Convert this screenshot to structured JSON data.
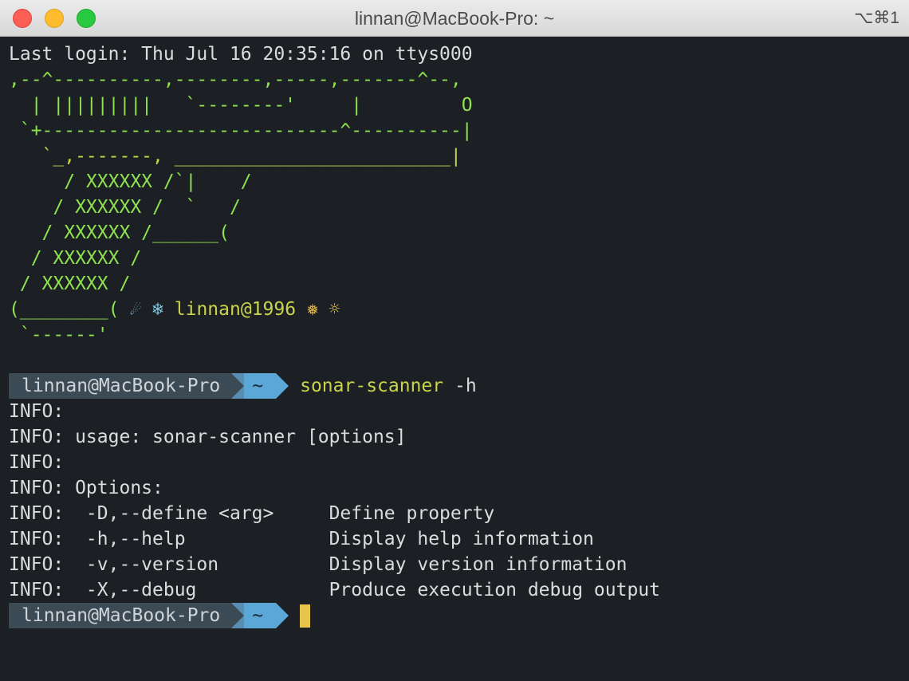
{
  "window": {
    "title": "linnan@MacBook-Pro: ~",
    "shortcut": "⌥⌘1"
  },
  "terminal": {
    "last_login": "Last login: Thu Jul 16 20:35:16 on ttys000",
    "art": [
      ",--^----------,--------,-----,-------^--,",
      "  | |||||||||   `--------'     |         O",
      " `+---------------------------^----------|",
      "   `_,-------, _________________________|",
      "     / XXXXXX /`|    /",
      "    / XXXXXX /  `   /",
      "   / XXXXXX /______(",
      "  / XXXXXX /",
      " / XXXXXX /"
    ],
    "art_last": {
      "prefix": "(________( ",
      "emoji1": "☄",
      "emoji2": "❄",
      "signature": "linnan@1996",
      "emoji3": "❅",
      "emoji4": "☼"
    },
    "art_bottom": " `------'",
    "prompt1": {
      "user": "linnan@MacBook-Pro",
      "dir": "~",
      "command": "sonar-scanner",
      "argument": "-h"
    },
    "output": [
      "INFO:",
      "INFO: usage: sonar-scanner [options]",
      "INFO:",
      "INFO: Options:",
      "INFO:  -D,--define <arg>     Define property",
      "INFO:  -h,--help             Display help information",
      "INFO:  -v,--version          Display version information",
      "INFO:  -X,--debug            Produce execution debug output"
    ],
    "prompt2": {
      "user": "linnan@MacBook-Pro",
      "dir": "~"
    }
  },
  "colors": {
    "background": "#1c2024",
    "art": "#8ee34f",
    "command": "#c9d44a",
    "prompt_user_bg": "#3c4a55",
    "prompt_dir_bg": "#5ba7d8",
    "cursor": "#e6c64a"
  }
}
